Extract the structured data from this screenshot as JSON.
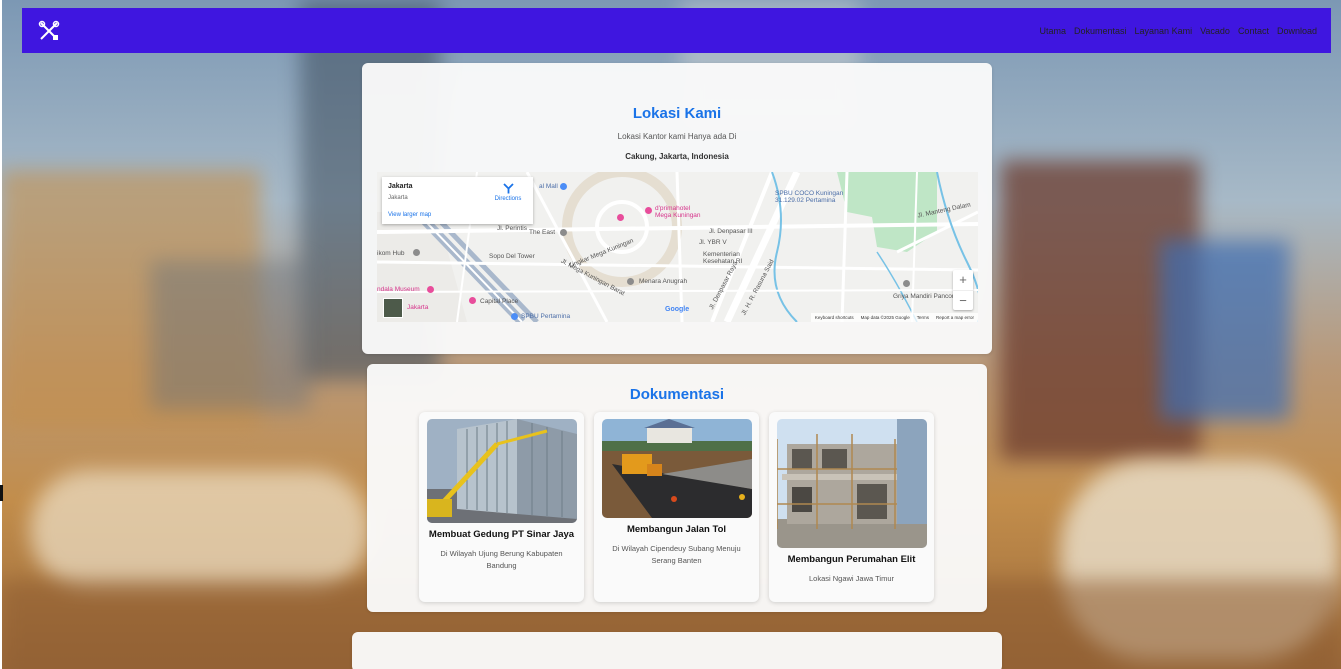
{
  "nav": {
    "logo": "tools-icon",
    "links": [
      "Utama",
      "Dokumentasi",
      "Layanan Kami",
      "Vacado",
      "Contact",
      "Download"
    ]
  },
  "location": {
    "title": "Lokasi Kami",
    "line1": "Lokasi Kantor kami Hanya ada Di",
    "line2": "Cakung, Jakarta, Indonesia",
    "map": {
      "info_title": "Jakarta",
      "info_sub": "Jakarta",
      "directions": "Directions",
      "view_larger": "View larger map",
      "google": "Google",
      "footer": [
        "Keyboard shortcuts",
        "Map data ©2025 Google",
        "Terms",
        "Report a map error"
      ],
      "labels": {
        "spbu_coco": "SPBU COCO Kuningan",
        "spbu_coco_addr": "31.129.02 Pertamina",
        "djp_hotel": "d'primahotel",
        "djp_hotel2": "Mega Kuningan",
        "mall": "al Mall",
        "jl_mantang": "Jl. Manteng Dalam",
        "jl_perintis": "Jl. Perintis",
        "the_east": "The East",
        "jl_denpasar3": "Jl. Denpasar III",
        "jl_ybr": "Jl. YBR V",
        "kementerian": "Kementerian",
        "kesehatan": "Kesehatan RI",
        "ikom_hub": "ikom Hub",
        "sopo_del": "Sopo Del Tower",
        "lingkar": "Lingkar Mega Kuningan",
        "jl_mega_barat": "Jl. Mega Kuningan Barat",
        "menara_anugrah": "Menara Anugrah",
        "griya_mandiri": "Griya Mandiri Pancoran",
        "museum": "ndala Museum",
        "capital_place": "Capital Place",
        "jakarta_poi": "Jakarta",
        "spbu_pertamina": "SPBU Pertamina",
        "jl_denpasar_raya": "Jl. Denpasar Raya",
        "jl_rasuna": "Jl. H. R. Rasuna Said"
      }
    }
  },
  "docs": {
    "title": "Dokumentasi",
    "items": [
      {
        "title": "Membuat Gedung PT Sinar Jaya",
        "desc": "Di Wilayah Ujung Berung Kabupaten Bandung"
      },
      {
        "title": "Membangun Jalan Tol",
        "desc": "Di Wilayah Cipendeuy Subang Menuju Serang Banten"
      },
      {
        "title": "Membangun Perumahan Elit",
        "desc": "Lokasi Ngawi Jawa Timur"
      }
    ]
  },
  "colors": {
    "navbar": "#3f16e0",
    "accent": "#1a73e8"
  }
}
